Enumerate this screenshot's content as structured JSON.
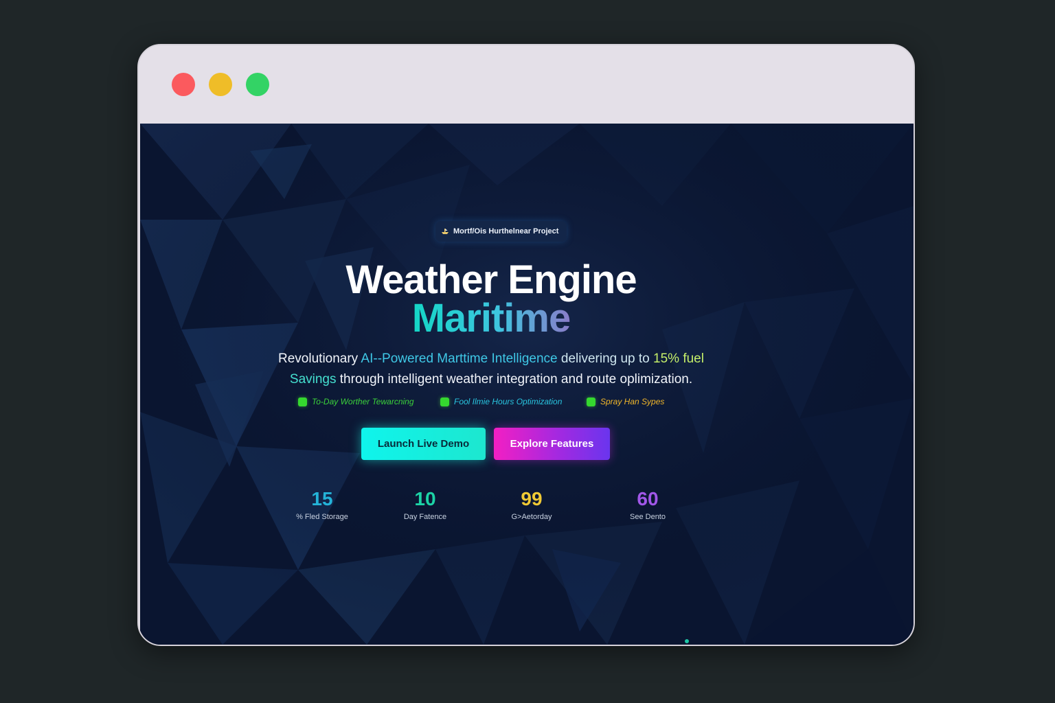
{
  "window": {
    "controls": [
      "close",
      "minimize",
      "maximize"
    ]
  },
  "hero": {
    "badge": {
      "icon": "ship-icon",
      "label": "Mortf/Ois Hurthelnear Project"
    },
    "title": "Weather Engine",
    "subtitle": "Maritime",
    "tagline": {
      "part1": "Revolutionary ",
      "part2": "AI--Powered Marttime Intelligence",
      "part3": " delivering up to ",
      "part4": "15% fuel",
      "part5": "Savings",
      "part6": " through intelligent weather integration and route oplimization."
    },
    "features": [
      {
        "label": "To-Day Worther Tewarcning",
        "color": "#3bd23a"
      },
      {
        "label": "Fool Ilmie Hours Optimization",
        "color": "#29c6e0"
      },
      {
        "label": "Spray Han Sypes",
        "color": "#f0b62a"
      }
    ],
    "buttons": {
      "primary": "Launch Live Demo",
      "secondary": "Explore Features"
    },
    "stats": [
      {
        "value": "15",
        "label": "% Fled Storage",
        "color": "#24b3d8"
      },
      {
        "value": "10",
        "label": "Day Fatence",
        "color": "#1cd3a6"
      },
      {
        "value": "99",
        "label": "G>Aetorday",
        "color": "#f0ca35"
      },
      {
        "value": "60",
        "label": "See Dento",
        "color": "#a157e8"
      }
    ]
  },
  "colors": {
    "background": "#1f2628",
    "titlebar": "#e4e0e8",
    "viewport": "#0b1630",
    "accent_cyan": "#0ff4ec",
    "accent_magenta": "#f31fc3"
  }
}
